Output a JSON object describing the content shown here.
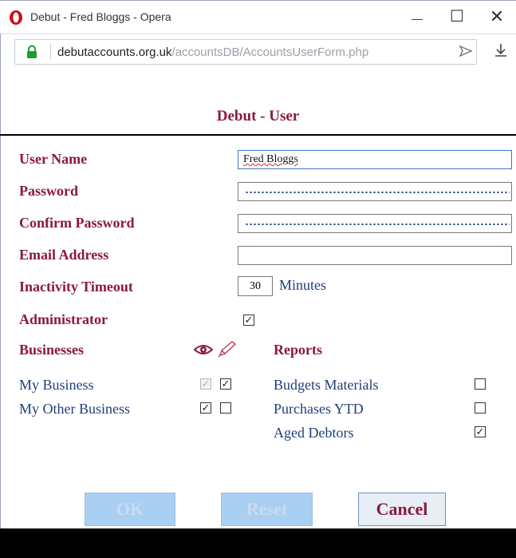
{
  "browser": {
    "window_title": "Debut - Fred Bloggs - Opera",
    "url_host": "debutaccounts.org.uk",
    "url_path": "/accountsDB/AccountsUserForm.php",
    "minimize_glyph": "—",
    "maximize_glyph": "☐",
    "close_glyph": "✕"
  },
  "app": {
    "title": "Debut - User"
  },
  "form": {
    "user_name_label": "User Name",
    "user_name_value": "Fred Bloggs",
    "password_label": "Password",
    "confirm_password_label": "Confirm Password",
    "email_label": "Email Address",
    "email_value": "",
    "inactivity_label": "Inactivity Timeout",
    "inactivity_value": "30",
    "minutes_label": "Minutes",
    "administrator_label": "Administrator",
    "administrator_checked": true
  },
  "businesses": {
    "heading": "Businesses",
    "items": [
      {
        "name": "My Business",
        "view": true,
        "view_disabled": true,
        "edit": true
      },
      {
        "name": "My Other Business",
        "view": true,
        "view_disabled": false,
        "edit": false
      }
    ]
  },
  "reports": {
    "heading": "Reports",
    "items": [
      {
        "name": "Budgets Materials",
        "checked": false
      },
      {
        "name": "Purchases YTD",
        "checked": false
      },
      {
        "name": "Aged Debtors",
        "checked": true
      }
    ]
  },
  "buttons": {
    "ok": "OK",
    "reset": "Reset",
    "cancel": "Cancel"
  },
  "colors": {
    "label": "#8b1a3b",
    "value_text": "#1f3f78",
    "disabled_button": "#a9cff3"
  }
}
